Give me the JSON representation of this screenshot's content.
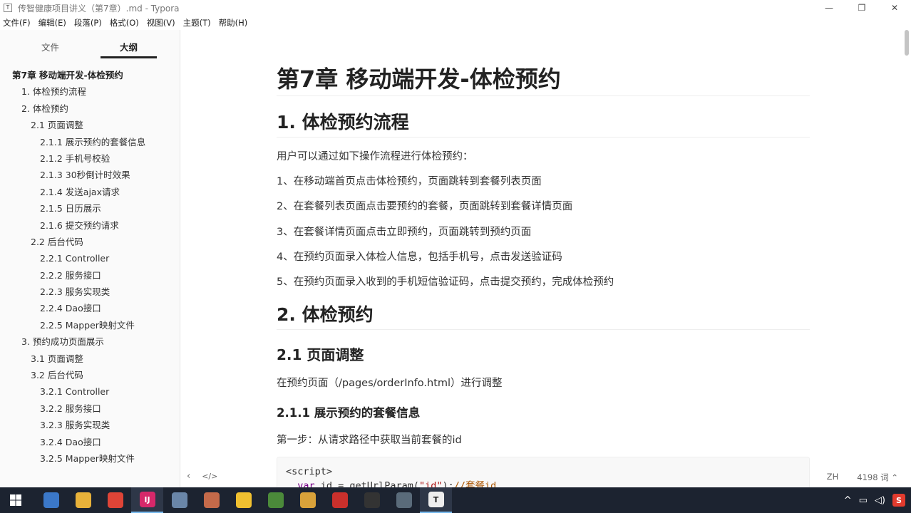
{
  "window": {
    "title": "传智健康项目讲义（第7章）.md - Typora",
    "app_icon_letter": "T",
    "controls": {
      "minimize": "—",
      "maximize": "❐",
      "close": "✕"
    }
  },
  "menu": [
    "文件(F)",
    "编辑(E)",
    "段落(P)",
    "格式(O)",
    "视图(V)",
    "主题(T)",
    "帮助(H)"
  ],
  "sidebar": {
    "tabs": {
      "files": "文件",
      "outline": "大纲"
    },
    "outline": [
      {
        "label": "第7章 移动端开发-体检预约",
        "level": 0
      },
      {
        "label": "1. 体检预约流程",
        "level": 1
      },
      {
        "label": "2. 体检预约",
        "level": 1
      },
      {
        "label": "2.1 页面调整",
        "level": 2
      },
      {
        "label": "2.1.1 展示预约的套餐信息",
        "level": 3
      },
      {
        "label": "2.1.2 手机号校验",
        "level": 3
      },
      {
        "label": "2.1.3 30秒倒计时效果",
        "level": 3
      },
      {
        "label": "2.1.4 发送ajax请求",
        "level": 3
      },
      {
        "label": "2.1.5 日历展示",
        "level": 3
      },
      {
        "label": "2.1.6 提交预约请求",
        "level": 3
      },
      {
        "label": "2.2 后台代码",
        "level": 2
      },
      {
        "label": "2.2.1 Controller",
        "level": 3
      },
      {
        "label": "2.2.2 服务接口",
        "level": 3
      },
      {
        "label": "2.2.3 服务实现类",
        "level": 3
      },
      {
        "label": "2.2.4 Dao接口",
        "level": 3
      },
      {
        "label": "2.2.5 Mapper映射文件",
        "level": 3
      },
      {
        "label": "3. 预约成功页面展示",
        "level": 1
      },
      {
        "label": "3.1 页面调整",
        "level": 2
      },
      {
        "label": "3.2 后台代码",
        "level": 2
      },
      {
        "label": "3.2.1 Controller",
        "level": 3
      },
      {
        "label": "3.2.2 服务接口",
        "level": 3
      },
      {
        "label": "3.2.3 服务实现类",
        "level": 3
      },
      {
        "label": "3.2.4 Dao接口",
        "level": 3
      },
      {
        "label": "3.2.5 Mapper映射文件",
        "level": 3
      }
    ]
  },
  "doc": {
    "h1": "第7章 移动端开发-体检预约",
    "sec1_title": "1. 体检预约流程",
    "sec1_intro": "用户可以通过如下操作流程进行体检预约：",
    "steps": [
      "1、在移动端首页点击体检预约，页面跳转到套餐列表页面",
      "2、在套餐列表页面点击要预约的套餐，页面跳转到套餐详情页面",
      "3、在套餐详情页面点击立即预约，页面跳转到预约页面",
      "4、在预约页面录入体检人信息，包括手机号，点击发送验证码",
      "5、在预约页面录入收到的手机短信验证码，点击提交预约，完成体检预约"
    ],
    "sec2_title": "2. 体检预约",
    "sec21_title": "2.1 页面调整",
    "sec21_text": "在预约页面（/pages/orderInfo.html）进行调整",
    "sec211_title": "2.1.1 展示预约的套餐信息",
    "step1_text": "第一步：从请求路径中获取当前套餐的id",
    "code": {
      "line1": "<script>",
      "line2_kw": "var",
      "line2_mid": " id = getUrlParam(",
      "line2_str": "\"id\"",
      "line2_end": ");",
      "line2_comment": "//套餐id"
    }
  },
  "status": {
    "back_icon": "‹",
    "source_icon": "</>",
    "lang": "ZH",
    "word_count": "4198 词 ⌃"
  },
  "taskbar": {
    "apps": [
      {
        "name": "user-app",
        "color": "#3b78c9",
        "glyph": ""
      },
      {
        "name": "file-explorer",
        "color": "#e8b23a",
        "glyph": ""
      },
      {
        "name": "chrome",
        "color": "#de4437",
        "glyph": ""
      },
      {
        "name": "intellij",
        "color": "#d6286a",
        "glyph": "IJ"
      },
      {
        "name": "feather-app",
        "color": "#6a86a8",
        "glyph": ""
      },
      {
        "name": "device-manager",
        "color": "#c46a4a",
        "glyph": ""
      },
      {
        "name": "note-app",
        "color": "#f0c030",
        "glyph": ""
      },
      {
        "name": "spreadsheet-app",
        "color": "#4b8a3a",
        "glyph": ""
      },
      {
        "name": "package-app",
        "color": "#d9a23a",
        "glyph": ""
      },
      {
        "name": "redis-app",
        "color": "#c9302c",
        "glyph": ""
      },
      {
        "name": "terminal",
        "color": "#333333",
        "glyph": ""
      },
      {
        "name": "window-app",
        "color": "#5a6b7a",
        "glyph": ""
      },
      {
        "name": "typora",
        "color": "#eeeeee",
        "glyph": "T"
      }
    ],
    "tray_ime": "S"
  }
}
